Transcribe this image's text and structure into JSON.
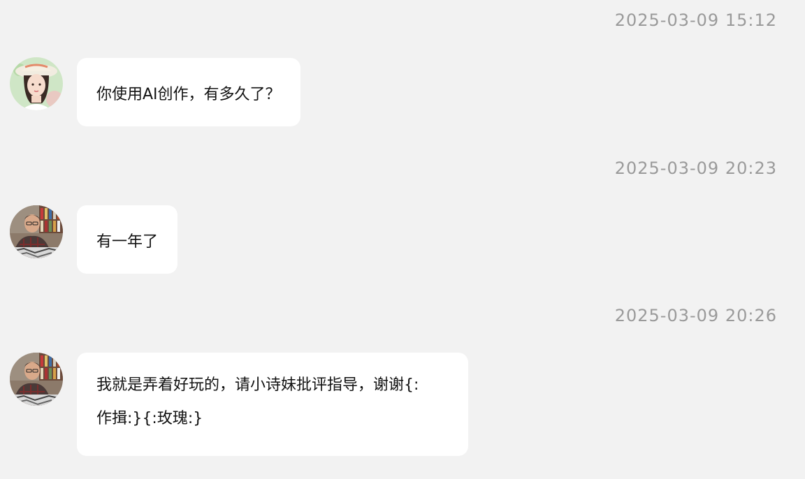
{
  "messages": [
    {
      "timestamp": "2025-03-09 15:12",
      "sender_avatar": "woman-sunhat-avatar",
      "lines": [
        "你使用AI创作，有多久了？"
      ]
    },
    {
      "timestamp": "2025-03-09 20:23",
      "sender_avatar": "man-bookshelf-avatar",
      "lines": [
        "有一年了"
      ]
    },
    {
      "timestamp": "2025-03-09 20:26",
      "sender_avatar": "man-bookshelf-avatar",
      "lines": [
        "我就是弄着好玩的，请小诗妹批评指导，谢谢{:",
        "作揖:}{:玫瑰:}"
      ]
    }
  ],
  "colors": {
    "background": "#f2f2f2",
    "bubble": "#ffffff",
    "timestamp": "#9a9a9a",
    "text": "#111111"
  }
}
